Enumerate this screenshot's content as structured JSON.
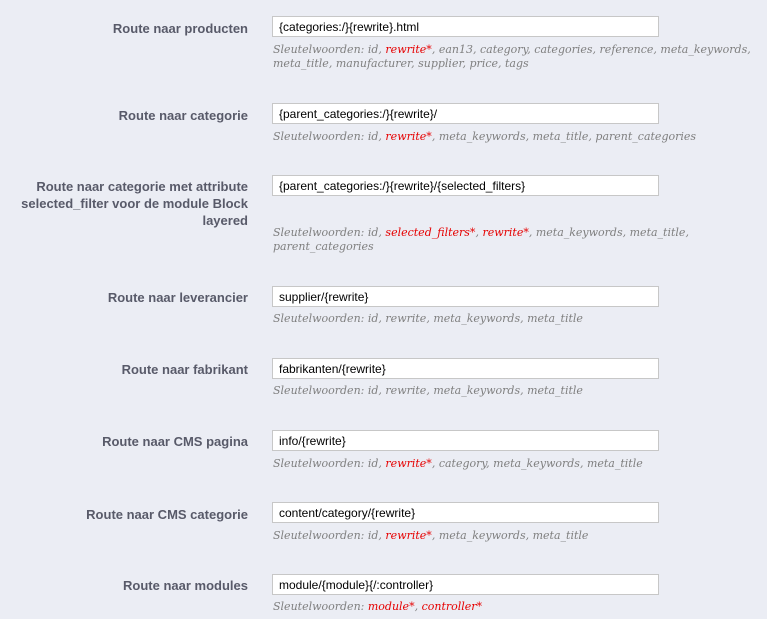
{
  "keywords_prefix": "Sleutelwoorden:",
  "routes": [
    {
      "label": "Route naar producten",
      "value": "{categories:/}{rewrite}.html",
      "keywords": [
        {
          "text": "id",
          "required": false
        },
        {
          "text": "rewrite*",
          "required": true
        },
        {
          "text": "ean13",
          "required": false
        },
        {
          "text": "category",
          "required": false
        },
        {
          "text": "categories",
          "required": false
        },
        {
          "text": "reference",
          "required": false
        },
        {
          "text": "meta_keywords",
          "required": false
        },
        {
          "text": "meta_title",
          "required": false
        },
        {
          "text": "manufacturer",
          "required": false
        },
        {
          "text": "supplier",
          "required": false
        },
        {
          "text": "price",
          "required": false
        },
        {
          "text": "tags",
          "required": false
        }
      ]
    },
    {
      "label": "Route naar categorie",
      "value": "{parent_categories:/}{rewrite}/",
      "keywords": [
        {
          "text": "id",
          "required": false
        },
        {
          "text": "rewrite*",
          "required": true
        },
        {
          "text": "meta_keywords",
          "required": false
        },
        {
          "text": "meta_title",
          "required": false
        },
        {
          "text": "parent_categories",
          "required": false
        }
      ]
    },
    {
      "label": "Route naar categorie met attribute selected_filter voor de module Block layered",
      "value": "{parent_categories:/}{rewrite}/{selected_filters}",
      "keywords": [
        {
          "text": "id",
          "required": false
        },
        {
          "text": "selected_filters*",
          "required": true
        },
        {
          "text": "rewrite*",
          "required": true
        },
        {
          "text": "meta_keywords",
          "required": false
        },
        {
          "text": "meta_title",
          "required": false
        },
        {
          "text": "parent_categories",
          "required": false
        }
      ]
    },
    {
      "label": "Route naar leverancier",
      "value": "supplier/{rewrite}",
      "keywords": [
        {
          "text": "id",
          "required": false
        },
        {
          "text": "rewrite",
          "required": false
        },
        {
          "text": "meta_keywords",
          "required": false
        },
        {
          "text": "meta_title",
          "required": false
        }
      ]
    },
    {
      "label": "Route naar fabrikant",
      "value": "fabrikanten/{rewrite}",
      "keywords": [
        {
          "text": "id",
          "required": false
        },
        {
          "text": "rewrite",
          "required": false
        },
        {
          "text": "meta_keywords",
          "required": false
        },
        {
          "text": "meta_title",
          "required": false
        }
      ]
    },
    {
      "label": "Route naar CMS pagina",
      "value": "info/{rewrite}",
      "keywords": [
        {
          "text": "id",
          "required": false
        },
        {
          "text": "rewrite*",
          "required": true
        },
        {
          "text": "category",
          "required": false
        },
        {
          "text": "meta_keywords",
          "required": false
        },
        {
          "text": "meta_title",
          "required": false
        }
      ]
    },
    {
      "label": "Route naar CMS categorie",
      "value": "content/category/{rewrite}",
      "keywords": [
        {
          "text": "id",
          "required": false
        },
        {
          "text": "rewrite*",
          "required": true
        },
        {
          "text": "meta_keywords",
          "required": false
        },
        {
          "text": "meta_title",
          "required": false
        }
      ]
    },
    {
      "label": "Route naar modules",
      "value": "module/{module}{/:controller}",
      "keywords": [
        {
          "text": "module*",
          "required": true
        },
        {
          "text": "controller*",
          "required": true
        }
      ]
    }
  ],
  "colors": {
    "background": "#ebedf4",
    "label": "#585a69",
    "hint": "#7f7f7f",
    "required": "#e60000"
  }
}
